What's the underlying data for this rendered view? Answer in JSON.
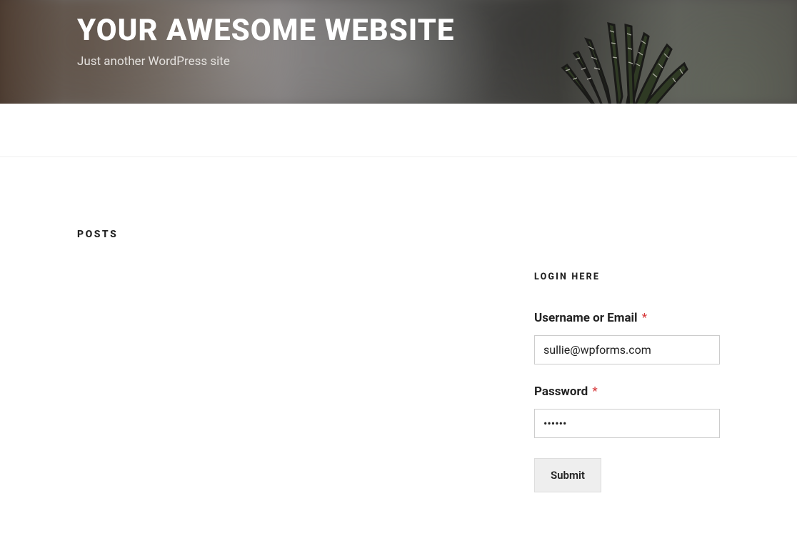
{
  "site": {
    "title": "YOUR AWESOME WEBSITE",
    "tagline": "Just another WordPress site"
  },
  "main": {
    "posts_heading": "POSTS"
  },
  "sidebar": {
    "login": {
      "widget_title": "LOGIN HERE",
      "username_label": "Username or Email",
      "username_value": "sullie@wpforms.com",
      "password_label": "Password",
      "password_value": "......",
      "submit_label": "Submit",
      "required_marker": "*"
    }
  }
}
